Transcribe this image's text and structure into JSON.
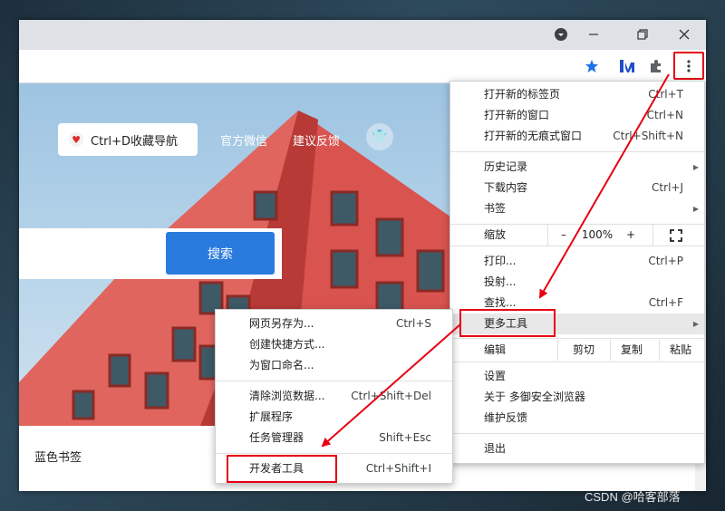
{
  "toolbar": {
    "star_icon": "star-icon",
    "extension_icon": "puzzle-icon",
    "menu_icon": "vertical-dots-icon"
  },
  "page": {
    "nav_pill": "Ctrl+D收藏导航",
    "nav_links": [
      "官方微信",
      "建议反馈"
    ],
    "search_button": "搜索",
    "bookmark_label": "蓝色书签"
  },
  "menu": {
    "items": [
      {
        "label": "打开新的标签页",
        "shortcut": "Ctrl+T"
      },
      {
        "label": "打开新的窗口",
        "shortcut": "Ctrl+N"
      },
      {
        "label": "打开新的无痕式窗口",
        "shortcut": "Ctrl+Shift+N"
      },
      {
        "label": "历史记录",
        "shortcut": ""
      },
      {
        "label": "下载内容",
        "shortcut": "Ctrl+J"
      },
      {
        "label": "书签",
        "shortcut": ""
      },
      {
        "label": "打印...",
        "shortcut": "Ctrl+P"
      },
      {
        "label": "投射...",
        "shortcut": ""
      },
      {
        "label": "查找...",
        "shortcut": "Ctrl+F"
      },
      {
        "label": "更多工具",
        "shortcut": ""
      },
      {
        "label": "设置",
        "shortcut": ""
      },
      {
        "label": "关于 多御安全浏览器",
        "shortcut": ""
      },
      {
        "label": "维护反馈",
        "shortcut": ""
      },
      {
        "label": "退出",
        "shortcut": ""
      }
    ],
    "zoom": {
      "label": "缩放",
      "minus": "–",
      "value": "100%",
      "plus": "+"
    },
    "edit": {
      "label": "编辑",
      "cut": "剪切",
      "copy": "复制",
      "paste": "粘贴"
    }
  },
  "submenu": {
    "items": [
      {
        "label": "网页另存为...",
        "shortcut": "Ctrl+S"
      },
      {
        "label": "创建快捷方式...",
        "shortcut": ""
      },
      {
        "label": "为窗口命名...",
        "shortcut": ""
      },
      {
        "label": "清除浏览数据...",
        "shortcut": "Ctrl+Shift+Del"
      },
      {
        "label": "扩展程序",
        "shortcut": ""
      },
      {
        "label": "任务管理器",
        "shortcut": "Shift+Esc"
      },
      {
        "label": "开发者工具",
        "shortcut": "Ctrl+Shift+I"
      }
    ]
  },
  "watermark": "CSDN @哈客部落",
  "colors": {
    "annotation": "#e60012",
    "accent": "#2a7bde",
    "titlebar": "#dee1e6"
  }
}
